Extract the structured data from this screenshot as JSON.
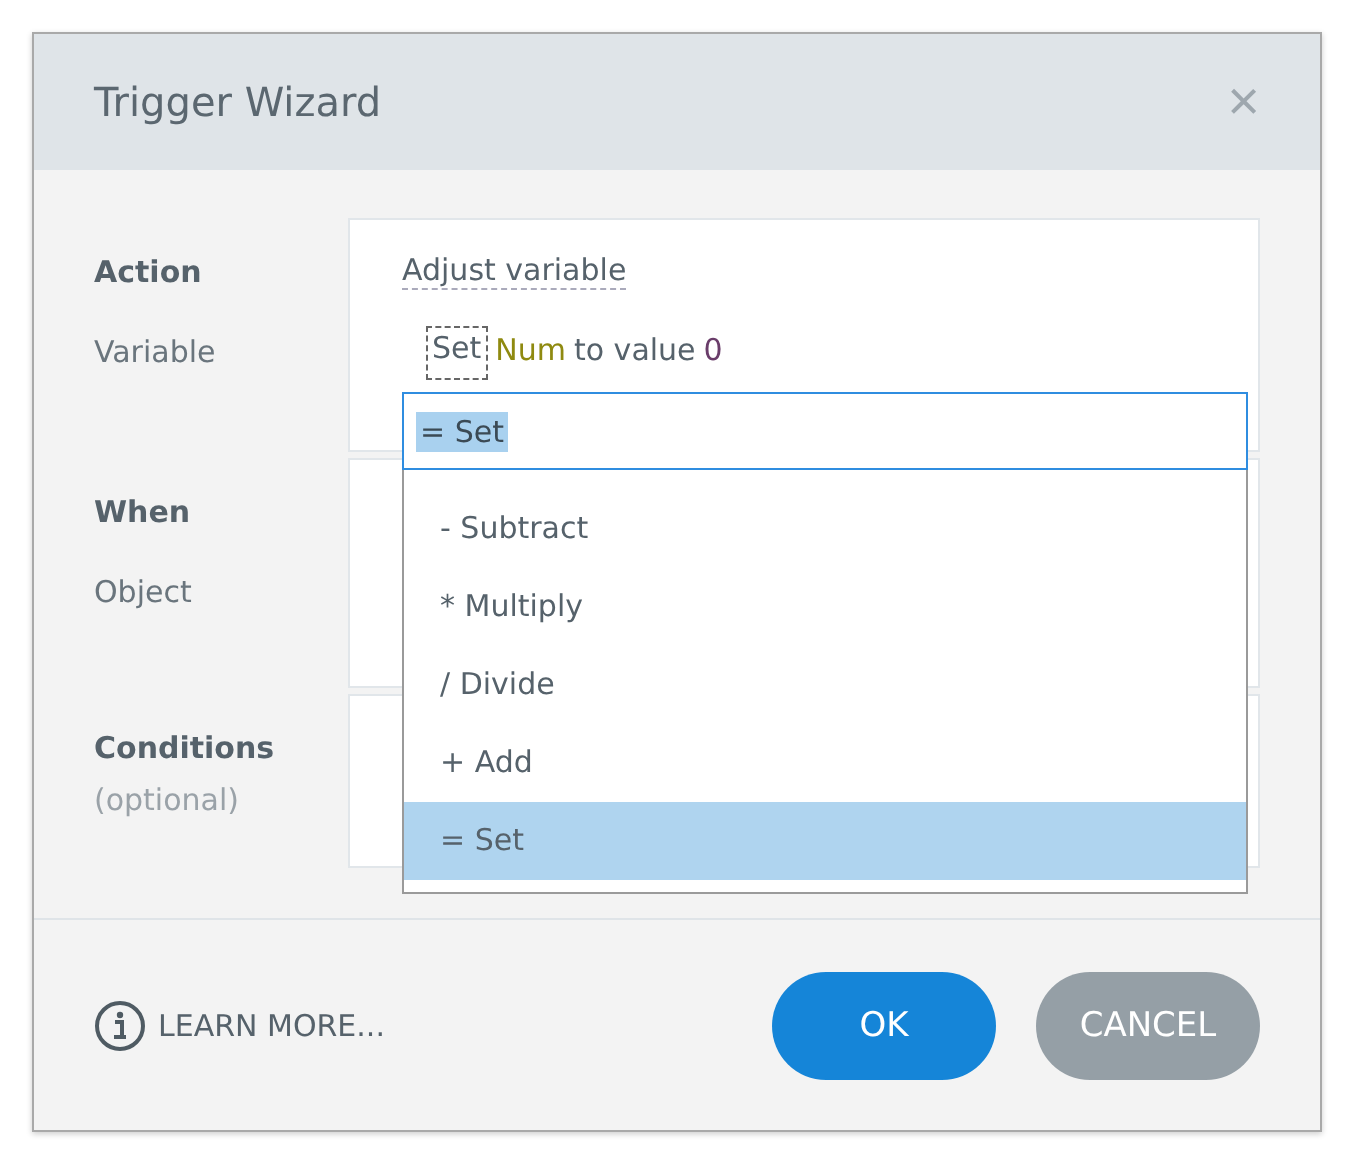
{
  "window": {
    "title": "Trigger Wizard",
    "close": "×"
  },
  "sections": [
    {
      "label": "Action",
      "sublabel": "Variable",
      "action": "Adjust variable",
      "sentence": [
        {
          "kind": "operator",
          "text": "Set"
        },
        {
          "kind": "variable",
          "text": "Num"
        },
        {
          "kind": "plain",
          "text": "to value"
        },
        {
          "kind": "number",
          "text": "0"
        }
      ]
    },
    {
      "label": "When",
      "sublabel": "Object"
    },
    {
      "label": "Conditions",
      "sublabel": "(optional)"
    }
  ],
  "dropdown": {
    "value": "= Set",
    "options": [
      {
        "label": "- Subtract",
        "selected": false
      },
      {
        "label": "* Multiply",
        "selected": false
      },
      {
        "label": "/ Divide",
        "selected": false
      },
      {
        "label": "+ Add",
        "selected": false
      },
      {
        "label": "= Set",
        "selected": true
      }
    ]
  },
  "footer": {
    "learn_more": "LEARN MORE...",
    "ok": "OK",
    "cancel": "CANCEL"
  }
}
